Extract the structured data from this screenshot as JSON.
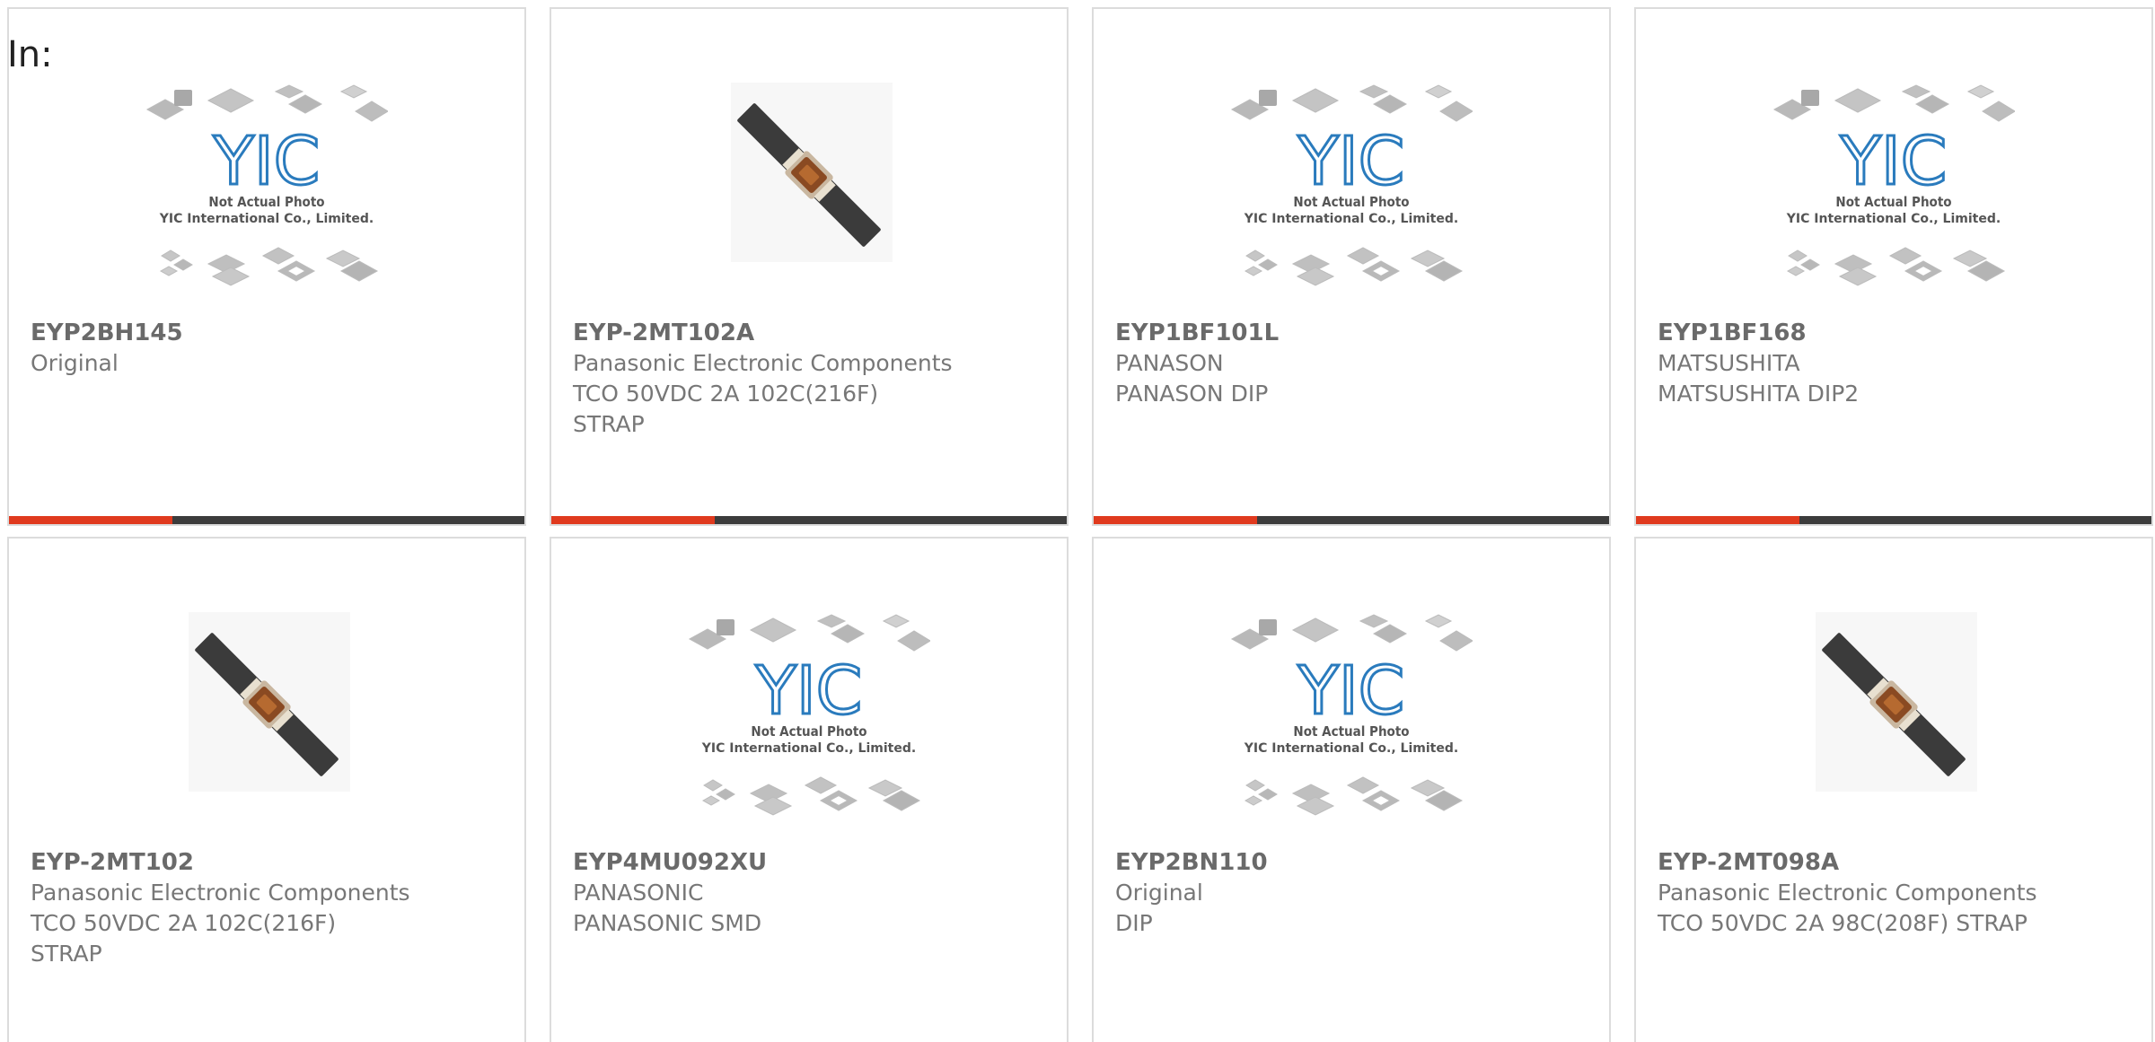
{
  "header": {
    "prefix_label": "In:"
  },
  "accent_color": "#e03a1e",
  "bar_color": "#3c3c3c",
  "placeholder_text": {
    "line1": "Not Actual Photo",
    "line2": "YIC International Co., Limited.",
    "logo": "YIC"
  },
  "products": [
    {
      "part_number": "EYP2BH145",
      "lines": [
        "Original"
      ],
      "image": "placeholder-logo"
    },
    {
      "part_number": "EYP-2MT102A",
      "lines": [
        "Panasonic Electronic Components",
        "TCO 50VDC 2A 102C(216F)",
        "STRAP"
      ],
      "image": "strap-fuse"
    },
    {
      "part_number": "EYP1BF101L",
      "lines": [
        "PANASON",
        "PANASON DIP"
      ],
      "image": "placeholder-logo"
    },
    {
      "part_number": "EYP1BF168",
      "lines": [
        "MATSUSHITA",
        "MATSUSHITA DIP2"
      ],
      "image": "placeholder-logo"
    },
    {
      "part_number": "EYP-2MT102",
      "lines": [
        "Panasonic Electronic Components",
        "TCO 50VDC 2A 102C(216F)",
        "STRAP"
      ],
      "image": "strap-fuse"
    },
    {
      "part_number": "EYP4MU092XU",
      "lines": [
        "PANASONIC",
        "PANASONIC SMD"
      ],
      "image": "placeholder-logo"
    },
    {
      "part_number": "EYP2BN110",
      "lines": [
        "Original",
        "DIP"
      ],
      "image": "placeholder-logo"
    },
    {
      "part_number": "EYP-2MT098A",
      "lines": [
        "Panasonic Electronic Components",
        "TCO 50VDC 2A 98C(208F) STRAP"
      ],
      "image": "strap-fuse"
    }
  ]
}
